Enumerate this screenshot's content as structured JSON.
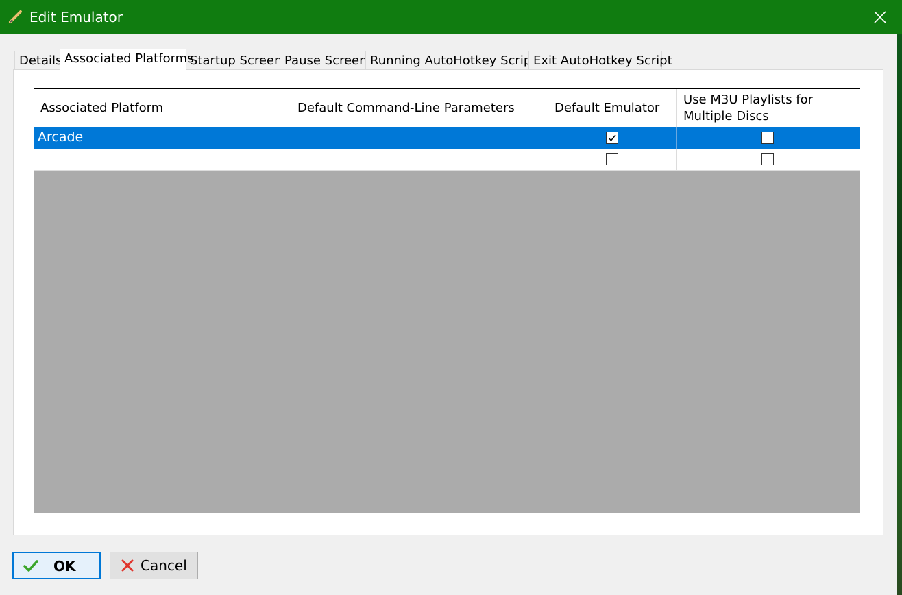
{
  "window": {
    "title": "Edit Emulator",
    "icon": "pencil-icon",
    "close_icon": "close-icon"
  },
  "tabs": [
    {
      "label": "Details"
    },
    {
      "label": "Associated Platforms",
      "active": true
    },
    {
      "label": "Startup Screen"
    },
    {
      "label": "Pause Screen"
    },
    {
      "label": "Running AutoHotkey Script"
    },
    {
      "label": "Exit AutoHotkey Script"
    }
  ],
  "grid": {
    "headers": {
      "platform": "Associated Platform",
      "params": "Default Command-Line Parameters",
      "default": "Default Emulator",
      "m3u_line1": "Use M3U Playlists for",
      "m3u_line2": "Multiple Discs"
    },
    "rows": [
      {
        "platform": "Arcade",
        "params": "",
        "default_emulator": true,
        "use_m3u": false,
        "selected": true
      },
      {
        "platform": "",
        "params": "",
        "default_emulator": false,
        "use_m3u": false,
        "selected": false
      }
    ]
  },
  "buttons": {
    "ok": "OK",
    "cancel": "Cancel"
  },
  "colors": {
    "titlebar": "#107c10",
    "selection": "#0078d7"
  }
}
